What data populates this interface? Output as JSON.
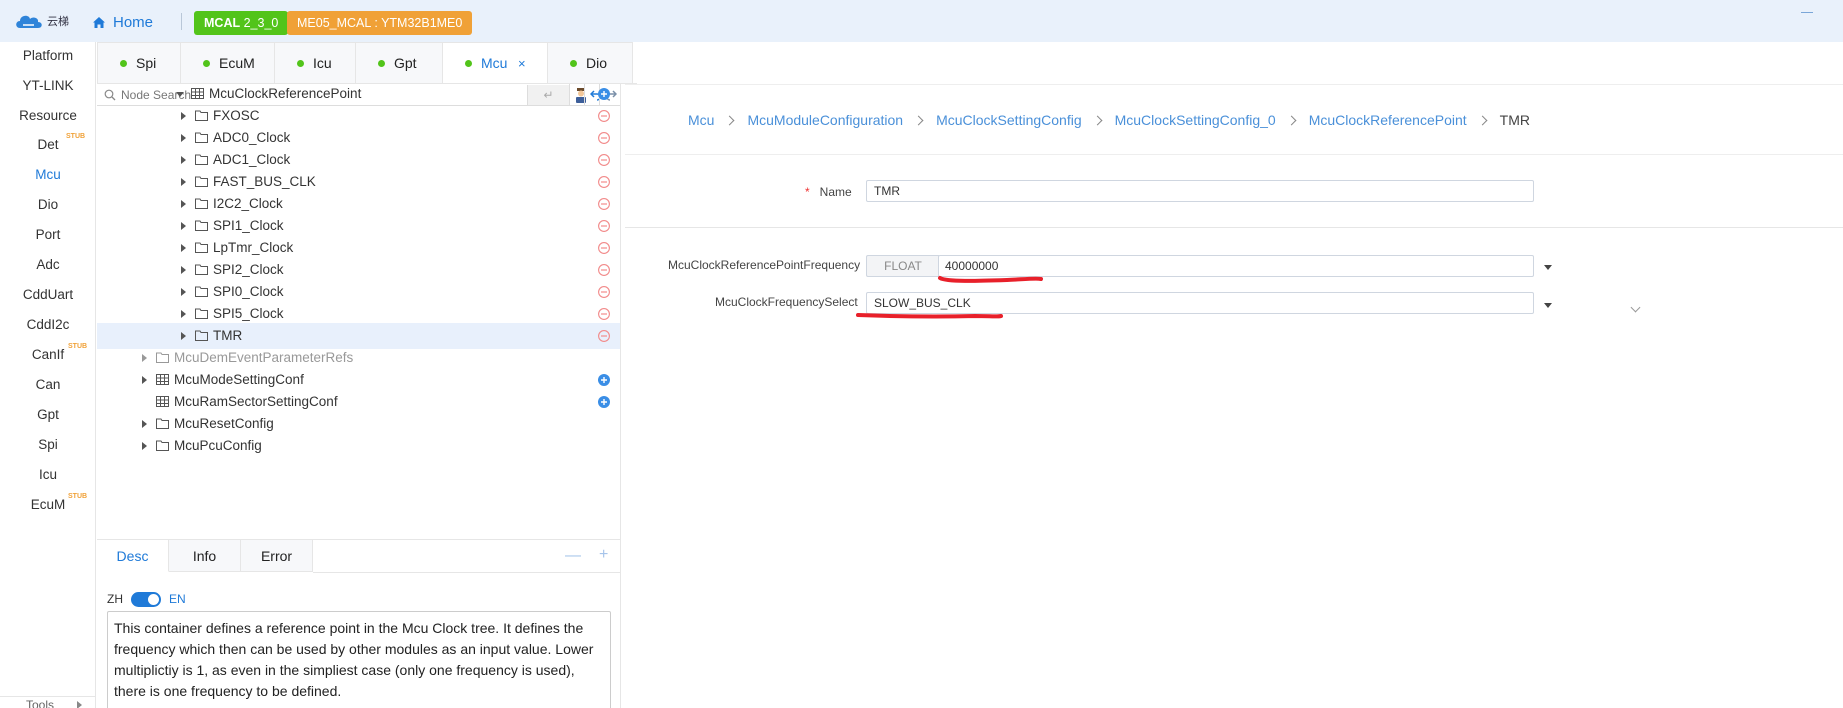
{
  "header": {
    "logo_text": "云梯",
    "home_label": "Home",
    "mcal_prefix": "MCAL",
    "mcal_version": "2_3_0",
    "chip_label": "ME05_MCAL : YTM32B1ME0"
  },
  "colors": {
    "accent": "#1f7ad8",
    "status_green": "#52c41a",
    "chip_orange": "#f0a137",
    "annotation_red": "#e8202a",
    "remove_red": "#f28b8b"
  },
  "nav": {
    "items": [
      {
        "label": "Platform",
        "stub": ""
      },
      {
        "label": "YT-LINK",
        "stub": ""
      },
      {
        "label": "Resource",
        "stub": ""
      },
      {
        "label": "Det",
        "stub": "STUB"
      },
      {
        "label": "Mcu",
        "stub": ""
      },
      {
        "label": "Dio",
        "stub": ""
      },
      {
        "label": "Port",
        "stub": ""
      },
      {
        "label": "Adc",
        "stub": ""
      },
      {
        "label": "CddUart",
        "stub": ""
      },
      {
        "label": "CddI2c",
        "stub": ""
      },
      {
        "label": "CanIf",
        "stub": "STUB"
      },
      {
        "label": "Can",
        "stub": ""
      },
      {
        "label": "Gpt",
        "stub": ""
      },
      {
        "label": "Spi",
        "stub": ""
      },
      {
        "label": "Icu",
        "stub": ""
      },
      {
        "label": "EcuM",
        "stub": "STUB"
      }
    ],
    "active": "Mcu",
    "tools_label": "Tools"
  },
  "tabs": [
    {
      "label": "Spi"
    },
    {
      "label": "EcuM"
    },
    {
      "label": "Icu"
    },
    {
      "label": "Gpt"
    },
    {
      "label": "Mcu",
      "close": "×"
    },
    {
      "label": "Dio"
    }
  ],
  "search": {
    "placeholder": "Node Search",
    "enter_symbol": "↵"
  },
  "tree": {
    "rows": [
      {
        "label": "McuClockReferencePoint",
        "icon": "table-icon",
        "caret": "down",
        "action": "add-icon"
      },
      {
        "label": "FXOSC",
        "icon": "folder-icon",
        "caret": "right",
        "action": "remove-icon"
      },
      {
        "label": "ADC0_Clock",
        "icon": "folder-icon",
        "caret": "right",
        "action": "remove-icon"
      },
      {
        "label": "ADC1_Clock",
        "icon": "folder-icon",
        "caret": "right",
        "action": "remove-icon"
      },
      {
        "label": "FAST_BUS_CLK",
        "icon": "folder-icon",
        "caret": "right",
        "action": "remove-icon"
      },
      {
        "label": "I2C2_Clock",
        "icon": "folder-icon",
        "caret": "right",
        "action": "remove-icon"
      },
      {
        "label": "SPI1_Clock",
        "icon": "folder-icon",
        "caret": "right",
        "action": "remove-icon"
      },
      {
        "label": "LpTmr_Clock",
        "icon": "folder-icon",
        "caret": "right",
        "action": "remove-icon"
      },
      {
        "label": "SPI2_Clock",
        "icon": "folder-icon",
        "caret": "right",
        "action": "remove-icon"
      },
      {
        "label": "SPI0_Clock",
        "icon": "folder-icon",
        "caret": "right",
        "action": "remove-icon"
      },
      {
        "label": "SPI5_Clock",
        "icon": "folder-icon",
        "caret": "right",
        "action": "remove-icon"
      },
      {
        "label": "TMR",
        "icon": "folder-icon",
        "caret": "right",
        "action": "remove-icon",
        "selected": true
      },
      {
        "label": "McuDemEventParameterRefs",
        "icon": "folder-icon",
        "caret": "right",
        "action": "",
        "disabled": true
      },
      {
        "label": "McuModeSettingConf",
        "icon": "table-icon",
        "caret": "right",
        "action": "add-icon"
      },
      {
        "label": "McuRamSectorSettingConf",
        "icon": "table-icon",
        "caret": "",
        "action": "add-icon"
      },
      {
        "label": "McuResetConfig",
        "icon": "folder-icon",
        "caret": "right",
        "action": ""
      },
      {
        "label": "McuPcuConfig",
        "icon": "folder-icon",
        "caret": "right",
        "action": ""
      }
    ]
  },
  "desc_panel": {
    "tabs": [
      "Desc",
      "Info",
      "Error"
    ],
    "minus": "—",
    "plus": "+",
    "lang_zh": "ZH",
    "lang_en": "EN",
    "text": "This container defines a reference point in the Mcu Clock tree. It defines the frequency which then can be used by other modules as an input value. Lower multiplictiy is 1, as even in the simpliest case (only one frequency is used), there is one frequency to be defined."
  },
  "breadcrumb": [
    "Mcu",
    "McuModuleConfiguration",
    "McuClockSettingConfig",
    "McuClockSettingConfig_0",
    "McuClockReferencePoint",
    "TMR"
  ],
  "form": {
    "name_required": "*",
    "name_label": "Name",
    "name_value": "TMR",
    "freq_label": "McuClockReferencePointFrequency",
    "freq_type": "FLOAT",
    "freq_value": "40000000",
    "select_label": "McuClockFrequencySelect",
    "select_value": "SLOW_BUS_CLK"
  }
}
